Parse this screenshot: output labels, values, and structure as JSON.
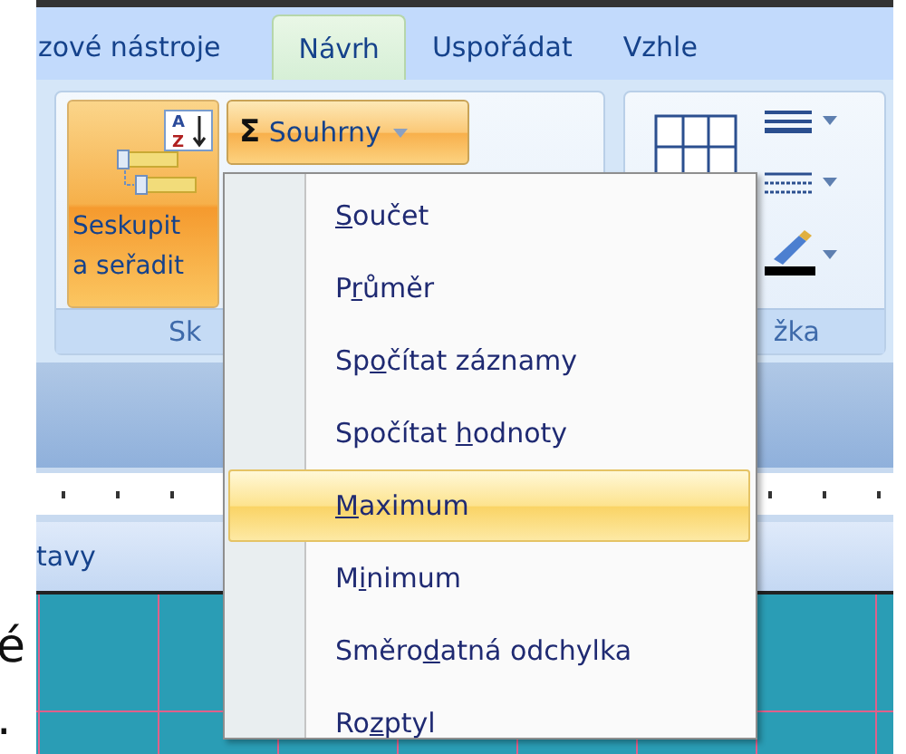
{
  "left_margin": {
    "texts": [
      "é",
      "."
    ]
  },
  "tabs": [
    {
      "label": "zové nástroje",
      "selected": false
    },
    {
      "label": "Návrh",
      "selected": true
    },
    {
      "label": "Uspořádat",
      "selected": false
    },
    {
      "label": "Vzhle",
      "selected": false
    }
  ],
  "ribbon": {
    "groups": [
      {
        "label": "Sk",
        "big_button": {
          "label": "Seskupit a seřadit",
          "highlighted": true,
          "icon_letters": [
            "A",
            "Z"
          ]
        },
        "dropdown_button": {
          "icon": "Σ",
          "label": "Souhrny",
          "highlighted": true
        }
      },
      {
        "label": "žka"
      }
    ]
  },
  "section_header": "tavy",
  "menu": {
    "items": [
      {
        "key": "S",
        "after": "oučet",
        "selected": false
      },
      {
        "before": "P",
        "key": "r",
        "after": "ůměr",
        "selected": false
      },
      {
        "before": "Sp",
        "key": "o",
        "after": "čítat záznamy",
        "selected": false
      },
      {
        "before": "Spočítat ",
        "key": "h",
        "after": "odnoty",
        "selected": false
      },
      {
        "key": "M",
        "after": "aximum",
        "selected": true
      },
      {
        "before": "M",
        "key": "i",
        "after": "nimum",
        "selected": false
      },
      {
        "before": "Směro",
        "key": "d",
        "after": "atná odchylka",
        "selected": false
      },
      {
        "before": "Ro",
        "key": "z",
        "after": "ptyl",
        "selected": false
      }
    ]
  }
}
